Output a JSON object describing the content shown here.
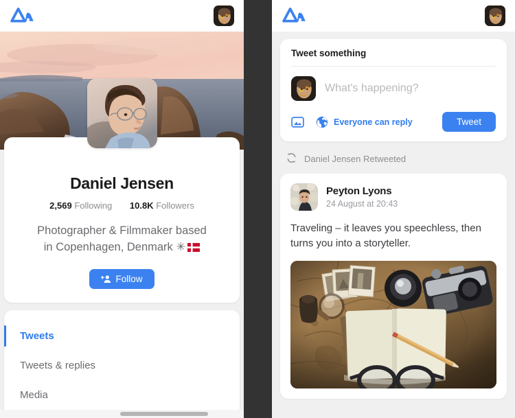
{
  "app": {
    "logo_icon": "mountain-logo-icon",
    "accent_color": "#3b82f0",
    "header_avatar_alt": "user-avatar"
  },
  "left_panel": {
    "profile": {
      "name": "Daniel Jensen",
      "following_count": "2,569",
      "following_label": "Following",
      "followers_count": "10.8K",
      "followers_label": "Followers",
      "bio_line1": "Photographer & Filmmaker based",
      "bio_line2": "in Copenhagen, Denmark ✳",
      "bio_flag": "denmark-flag",
      "follow_button": "Follow",
      "follow_icon": "person-add-icon",
      "cover_photo_alt": "coastal-sunset-cover-photo",
      "avatar_alt": "daniel-jensen-avatar"
    },
    "tabs": [
      {
        "label": "Tweets",
        "active": true
      },
      {
        "label": "Tweets & replies",
        "active": false
      },
      {
        "label": "Media",
        "active": false
      }
    ],
    "scrollbar": {
      "orientation": "horizontal"
    }
  },
  "right_panel": {
    "compose": {
      "title": "Tweet something",
      "placeholder": "What's happening?",
      "value": "",
      "image_icon": "image-icon",
      "globe_icon": "globe-icon",
      "reply_scope": "Everyone can reply",
      "submit_label": "Tweet",
      "avatar_alt": "user-avatar"
    },
    "feed": [
      {
        "retweet_icon": "retweet-icon",
        "retweet_label": "Daniel Jensen Retweeted",
        "author": "Peyton Lyons",
        "timestamp": "24 August at 20:43",
        "text": "Traveling – it leaves you speechless, then turns you into a storyteller.",
        "avatar_alt": "peyton-lyons-avatar",
        "media_alt": "vintage-travel-journal-photo"
      }
    ]
  }
}
